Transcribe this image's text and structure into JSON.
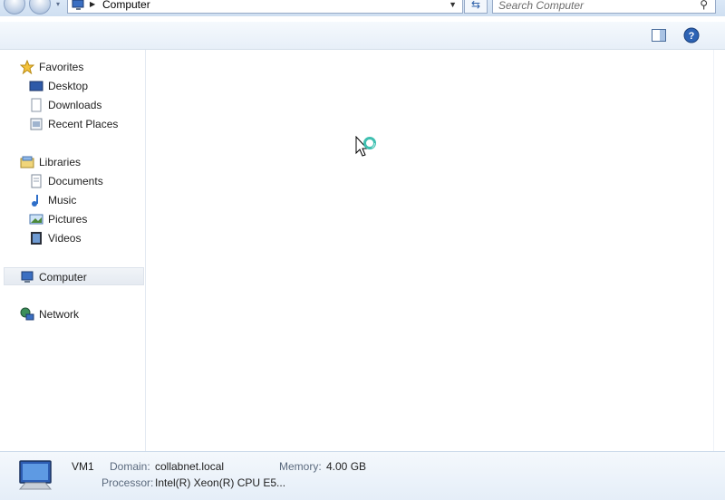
{
  "address_bar": {
    "crumb": "Computer"
  },
  "search": {
    "placeholder": "Search Computer"
  },
  "sidebar": {
    "favorites": {
      "label": "Favorites",
      "items": [
        {
          "label": "Desktop"
        },
        {
          "label": "Downloads"
        },
        {
          "label": "Recent Places"
        }
      ]
    },
    "libraries": {
      "label": "Libraries",
      "items": [
        {
          "label": "Documents"
        },
        {
          "label": "Music"
        },
        {
          "label": "Pictures"
        },
        {
          "label": "Videos"
        }
      ]
    },
    "computer": {
      "label": "Computer"
    },
    "network": {
      "label": "Network"
    }
  },
  "details": {
    "name": "VM1",
    "domain_label": "Domain:",
    "domain_value": "collabnet.local",
    "memory_label": "Memory:",
    "memory_value": "4.00 GB",
    "processor_label": "Processor:",
    "processor_value": "Intel(R) Xeon(R) CPU E5..."
  },
  "colors": {
    "accent": "#2a5ea8",
    "selection": "#e5eaf1",
    "details_bg": "#e5eef8"
  }
}
